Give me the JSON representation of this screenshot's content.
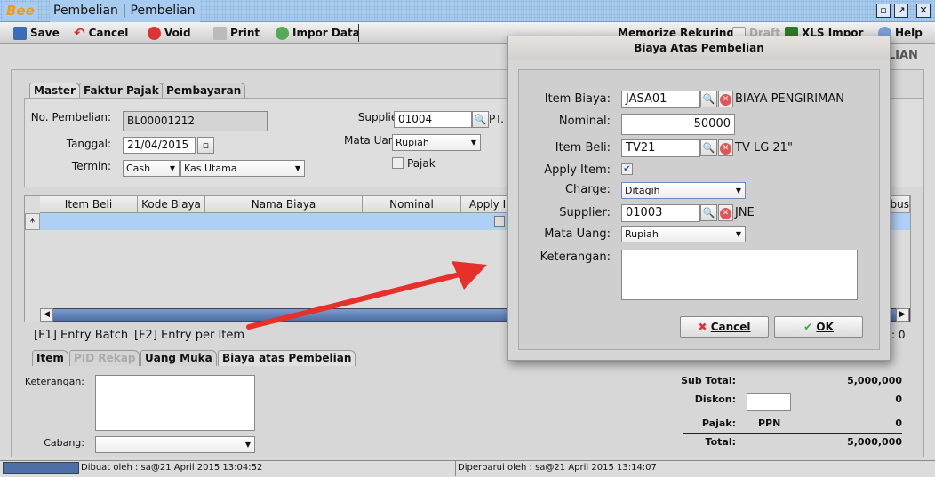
{
  "window": {
    "title": "Pembelian | Pembelian",
    "logo": "Bee"
  },
  "toolbar": {
    "save": "Save",
    "cancel": "Cancel",
    "void": "Void",
    "print": "Print",
    "impor_data": "Impor Data",
    "memorize": "Memorize",
    "rekuring": "Rekuring",
    "draft": "Draft",
    "xls_impor": "XLS Impor",
    "help": "Help"
  },
  "header_title": "ELIAN",
  "tabs": [
    "Master",
    "Faktur Pajak",
    "Pembayaran"
  ],
  "master": {
    "no_pembelian_label": "No. Pembelian:",
    "no_pembelian": "BL00001212",
    "tanggal_label": "Tanggal:",
    "tanggal": "21/04/2015",
    "termin_label": "Termin:",
    "termin": "Cash",
    "kas": "Kas Utama",
    "supplier_label": "Supplier:",
    "supplier": "01004",
    "supplier_name": "PT.",
    "mata_uang_label": "Mata Uang:",
    "mata_uang": "Rupiah",
    "pajak_label": "Pajak",
    "pajak_checked": false
  },
  "table": {
    "columns": [
      "Item Beli",
      "Kode Biaya",
      "Nama Biaya",
      "Nominal",
      "Apply I",
      "ribus"
    ],
    "new_row_marker": "*"
  },
  "shortcuts": {
    "f1": "[F1] Entry Batch",
    "f2": "[F2] Entry per Item",
    "count": ": 0"
  },
  "bottom_tabs": [
    "Item",
    "PID Rekap",
    "Uang Muka",
    "Biaya atas Pembelian"
  ],
  "footer": {
    "keterangan_label": "Keterangan:",
    "cabang_label": "Cabang:",
    "cabang": ""
  },
  "totals": {
    "sub_total_label": "Sub Total:",
    "sub_total": "5,000,000",
    "diskon_label": "Diskon:",
    "diskon": "0",
    "pajak_label": "Pajak:",
    "pajak_name": "PPN",
    "pajak": "0",
    "total_label": "Total:",
    "total": "5,000,000"
  },
  "status": {
    "dibuat": "Dibuat oleh : sa@21 April 2015  13:04:52",
    "diperbarui": "Diperbarui oleh : sa@21 April 2015  13:14:07"
  },
  "dialog": {
    "title": "Biaya Atas Pembelian",
    "item_biaya_label": "Item Biaya:",
    "item_biaya": "JASA01",
    "item_biaya_name": "BIAYA PENGIRIMAN",
    "nominal_label": "Nominal:",
    "nominal": "50000",
    "item_beli_label": "Item Beli:",
    "item_beli": "TV21",
    "item_beli_name": "TV LG 21\"",
    "apply_item_label": "Apply Item:",
    "apply_item": true,
    "charge_label": "Charge:",
    "charge": "Ditagih",
    "supplier_label": "Supplier:",
    "supplier": "01003",
    "supplier_name": "JNE",
    "mata_uang_label": "Mata Uang:",
    "mata_uang": "Rupiah",
    "keterangan_label": "Keterangan:",
    "keterangan": "",
    "cancel": "Cancel",
    "ok": "OK"
  },
  "colors": {
    "titlebar": "#a8ccf0",
    "selected_row": "#aed0f4",
    "arrow": "#e8302a"
  }
}
